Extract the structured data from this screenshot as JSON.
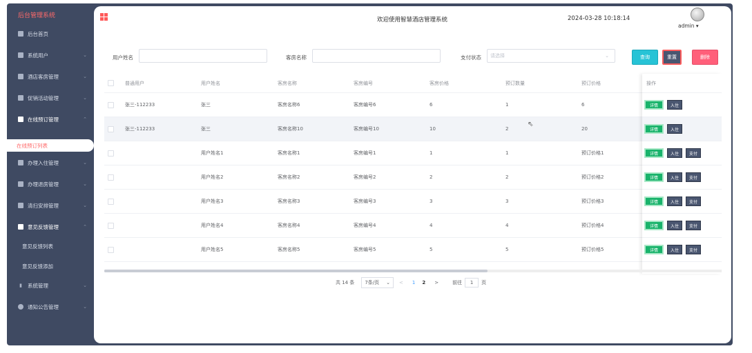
{
  "sidebar": {
    "app_title": "后台管理系统",
    "items": [
      {
        "label": "后台首页"
      },
      {
        "label": "系统用户",
        "chevron": "⌄"
      },
      {
        "label": "酒店客房管理",
        "chevron": "⌄"
      },
      {
        "label": "促销活动管理",
        "chevron": "⌄"
      },
      {
        "label": "在线预订管理",
        "chevron": "⌃"
      },
      {
        "label": "办理入住管理",
        "chevron": "⌄"
      },
      {
        "label": "办理退房管理",
        "chevron": "⌄"
      },
      {
        "label": "清扫安排管理",
        "chevron": "⌄"
      },
      {
        "label": "意见反馈管理",
        "chevron": "⌃"
      },
      {
        "label": "系统管理",
        "chevron": "⌄"
      },
      {
        "label": "通知公告管理",
        "chevron": "⌄"
      }
    ],
    "subitems": {
      "online_booking_list": "在线预订列表",
      "feedback_list": "意见反馈列表",
      "feedback_add": "意见反馈添加"
    }
  },
  "header": {
    "welcome": "欢迎使用智慧酒店管理系统",
    "datetime": "2024-03-28 10:18:14",
    "username": "admin ▾"
  },
  "filters": {
    "user_name_label": "用户姓名",
    "user_name_value": "",
    "room_name_label": "客房名称",
    "room_name_value": "",
    "pay_status_label": "支付状态",
    "pay_status_placeholder": "请选择",
    "query_label": "查询",
    "reset_label": "重置",
    "delete_label": "删除"
  },
  "table": {
    "columns": [
      "普通用户",
      "用户姓名",
      "客房名称",
      "客房编号",
      "客房价格",
      "预订数量",
      "预订价格",
      "操作"
    ],
    "rows": [
      {
        "user": "张三-112233",
        "name": "张三",
        "room_name": "客房名称6",
        "room_no": "客房编号6",
        "price": "6",
        "qty": "1",
        "total": "6",
        "paid": true
      },
      {
        "user": "张三-112233",
        "name": "张三",
        "room_name": "客房名称10",
        "room_no": "客房编号10",
        "price": "10",
        "qty": "2",
        "total": "20",
        "paid": true
      },
      {
        "user": "",
        "name": "用户姓名1",
        "room_name": "客房名称1",
        "room_no": "客房编号1",
        "price": "1",
        "qty": "1",
        "total": "预订价格1",
        "paid": false
      },
      {
        "user": "",
        "name": "用户姓名2",
        "room_name": "客房名称2",
        "room_no": "客房编号2",
        "price": "2",
        "qty": "2",
        "total": "预订价格2",
        "paid": false
      },
      {
        "user": "",
        "name": "用户姓名3",
        "room_name": "客房名称3",
        "room_no": "客房编号3",
        "price": "3",
        "qty": "3",
        "total": "预订价格3",
        "paid": false
      },
      {
        "user": "",
        "name": "用户姓名4",
        "room_name": "客房名称4",
        "room_no": "客房编号4",
        "price": "4",
        "qty": "4",
        "total": "预订价格4",
        "paid": false
      },
      {
        "user": "",
        "name": "用户姓名5",
        "room_name": "客房名称5",
        "room_no": "客房编号5",
        "price": "5",
        "qty": "5",
        "total": "预订价格5",
        "paid": false
      }
    ],
    "action_labels": {
      "detail": "详情",
      "checkin": "入住",
      "pay": "支付"
    }
  },
  "pagination": {
    "total": "共 14 条",
    "page_size": "7条/页",
    "size_chevron": "⌄",
    "prev": "<",
    "pages": [
      "1",
      "2"
    ],
    "current": "2",
    "next": ">",
    "goto_label": "前往",
    "goto_value": "1",
    "goto_suffix": "页"
  },
  "colors": {
    "sidebar_bg": "#3f4a62",
    "accent_red": "#ff5b5b",
    "query": "#27c3d6",
    "delete": "#ff5f7a",
    "detail": "#19b36b"
  }
}
